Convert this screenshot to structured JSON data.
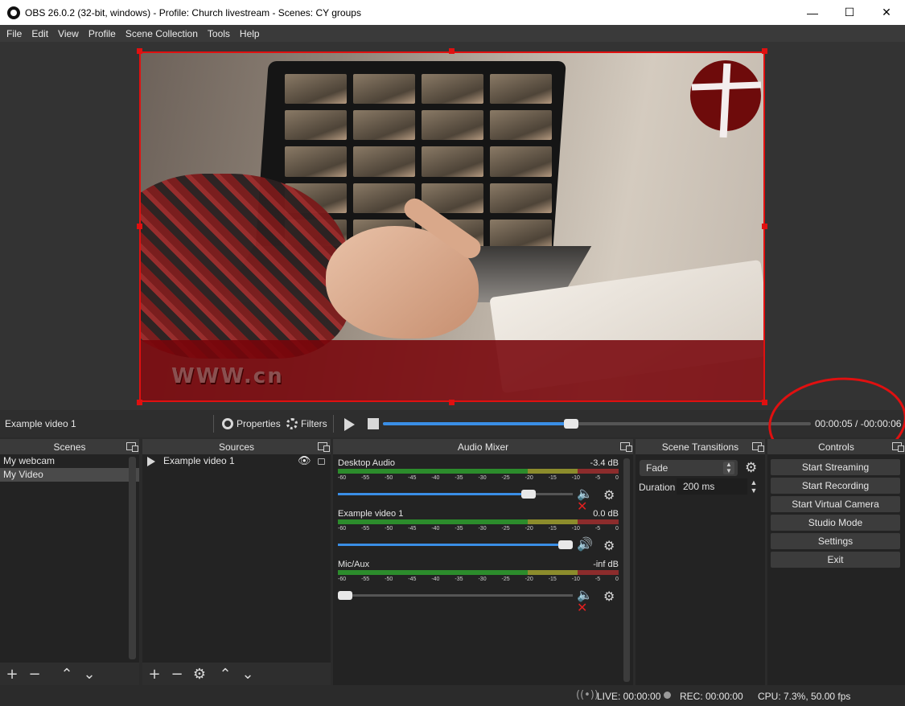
{
  "window": {
    "title": "OBS 26.0.2 (32-bit, windows) - Profile: Church livestream - Scenes: CY groups",
    "minimize": "—",
    "maximize": "☐",
    "close": "✕"
  },
  "menu": [
    "File",
    "Edit",
    "View",
    "Profile",
    "Scene Collection",
    "Tools",
    "Help"
  ],
  "preview": {
    "lower_third_text": "WWW.cn",
    "logo": "cross-logo"
  },
  "transport": {
    "source_name": "Example video 1",
    "properties_label": "Properties",
    "filters_label": "Filters",
    "time": "00:00:05 / -00:00:06",
    "seek_progress": 0.44
  },
  "scenes": {
    "title": "Scenes",
    "items": [
      {
        "label": "My webcam",
        "selected": false
      },
      {
        "label": "My Video",
        "selected": true
      }
    ]
  },
  "sources": {
    "title": "Sources",
    "items": [
      {
        "label": "Example video 1"
      }
    ]
  },
  "mixer": {
    "title": "Audio Mixer",
    "ticks": [
      "-60",
      "-55",
      "-50",
      "-45",
      "-40",
      "-35",
      "-30",
      "-25",
      "-20",
      "-15",
      "-10",
      "-5",
      "0"
    ],
    "channels": [
      {
        "name": "Desktop Audio",
        "db": "-3.4 dB",
        "volume": 0.81,
        "muted": true
      },
      {
        "name": "Example video 1",
        "db": "0.0 dB",
        "volume": 1.0,
        "muted": false
      },
      {
        "name": "Mic/Aux",
        "db": "-inf dB",
        "volume": 0.0,
        "muted": true
      }
    ]
  },
  "transitions": {
    "title": "Scene Transitions",
    "selected": "Fade",
    "duration_label": "Duration",
    "duration_value": "200 ms"
  },
  "controls": {
    "title": "Controls",
    "buttons": [
      "Start Streaming",
      "Start Recording",
      "Start Virtual Camera",
      "Studio Mode",
      "Settings",
      "Exit"
    ]
  },
  "status": {
    "live": "LIVE: 00:00:00",
    "rec": "REC: 00:00:00",
    "cpu": "CPU: 7.3%, 50.00 fps"
  },
  "colors": {
    "selection_red": "#e01010",
    "accent_blue": "#3a8ee6",
    "mute_red": "#e02020"
  }
}
